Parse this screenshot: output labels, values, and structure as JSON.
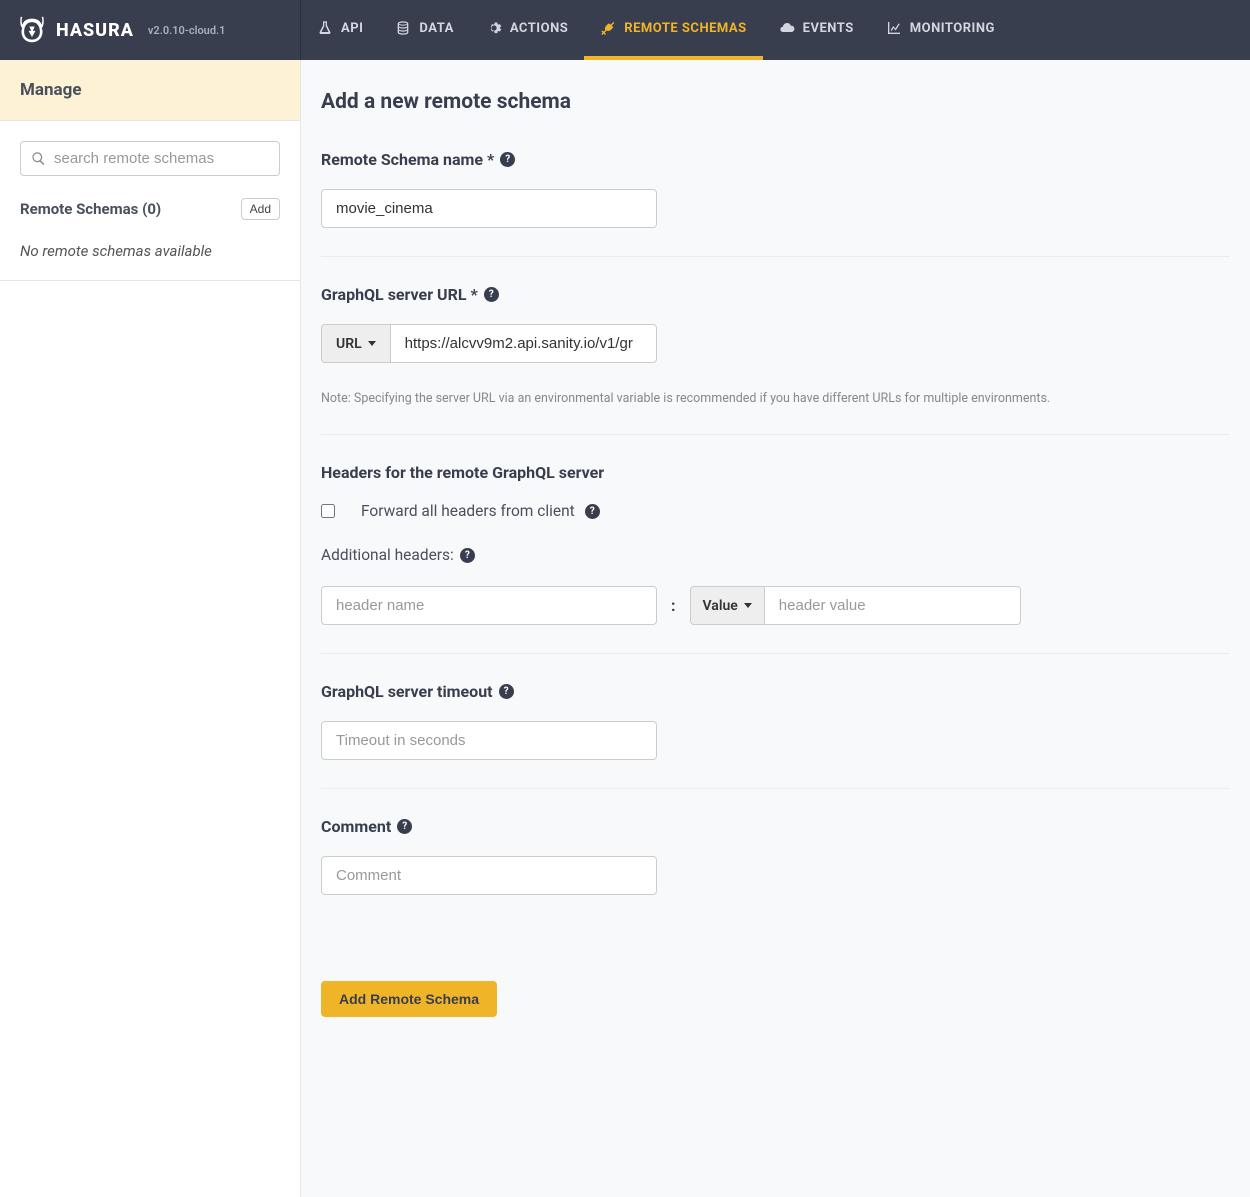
{
  "brand": {
    "name": "HASURA",
    "version": "v2.0.10-cloud.1"
  },
  "nav": {
    "api": "API",
    "data": "DATA",
    "actions": "ACTIONS",
    "remote_schemas": "REMOTE SCHEMAS",
    "events": "EVENTS",
    "monitoring": "MONITORING"
  },
  "sidebar": {
    "title": "Manage",
    "search_placeholder": "search remote schemas",
    "list_label": "Remote Schemas (0)",
    "add_label": "Add",
    "empty_text": "No remote schemas available"
  },
  "page": {
    "title": "Add a new remote schema",
    "schema_name": {
      "label": "Remote Schema name *",
      "value": "movie_cinema"
    },
    "server_url": {
      "label": "GraphQL server URL *",
      "type_dropdown": "URL",
      "value": "https://alcvv9m2.api.sanity.io/v1/gr",
      "note": "Note: Specifying the server URL via an environmental variable is recommended if you have different URLs for multiple environments."
    },
    "headers": {
      "label": "Headers for the remote GraphQL server",
      "forward_label": "Forward all headers from client",
      "additional_label": "Additional headers:",
      "name_placeholder": "header name",
      "value_dropdown": "Value",
      "value_placeholder": "header value"
    },
    "timeout": {
      "label": "GraphQL server timeout",
      "placeholder": "Timeout in seconds"
    },
    "comment": {
      "label": "Comment",
      "placeholder": "Comment"
    },
    "submit": "Add Remote Schema"
  }
}
